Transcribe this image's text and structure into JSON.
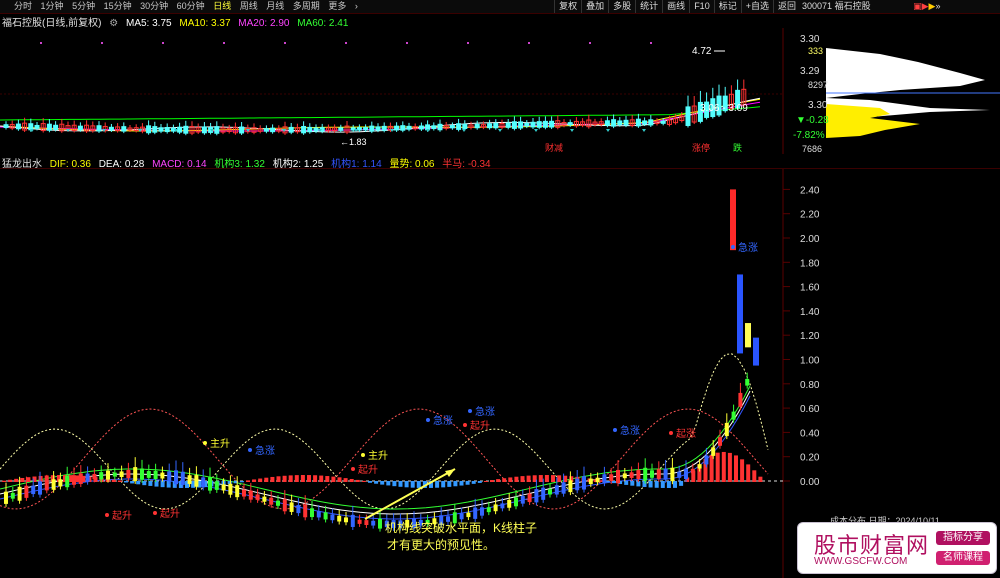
{
  "toolbar": {
    "timeframes": [
      "分时",
      "1分钟",
      "5分钟",
      "15分钟",
      "30分钟",
      "60分钟",
      "日线",
      "周线",
      "月线",
      "多周期",
      "更多"
    ],
    "active": "日线",
    "right_tools": [
      "复权",
      "叠加",
      "多股",
      "统计",
      "画线",
      "F10",
      "标记",
      "+自选",
      "返回"
    ]
  },
  "stock": {
    "code": "300071",
    "name": "福石控股"
  },
  "main_info": {
    "title": "福石控股(日线,前复权)",
    "ma5": "MA5: 3.75",
    "ma10": "MA10: 3.37",
    "ma20": "MA20: 2.90",
    "ma60": "MA60: 2.41"
  },
  "main_annotations": {
    "high": "4.72",
    "low": "1.83",
    "range": "3.06 - 3.09",
    "tags": [
      "财减",
      "涨停",
      "跌"
    ]
  },
  "main_axis": [
    "3.30",
    "3.29"
  ],
  "side_panel": {
    "labels": [
      "333",
      "8297",
      "3.30",
      "-0.28",
      "-7.82%",
      "7686"
    ]
  },
  "indicator_info": {
    "name": "猛龙出水",
    "dif": "DIF: 0.36",
    "dea": "DEA: 0.28",
    "macd": "MACD: 0.14",
    "jg3": "机构3: 1.32",
    "jg2": "机构2: 1.25",
    "jg1": "机构1: 1.14",
    "vol": "量势: 0.06",
    "half": "半马: -0.34"
  },
  "indicator_axis": [
    "2.40",
    "2.20",
    "2.00",
    "1.80",
    "1.60",
    "1.40",
    "1.20",
    "1.00",
    "0.80",
    "0.60",
    "0.40",
    "0.20",
    "0.00"
  ],
  "indicator_labels": {
    "zhu_sheng": "主升",
    "qi_sheng": "起升",
    "ji_zhang": "急涨",
    "qi_zhang": "起涨"
  },
  "note_text": [
    "机构线突破水平面，K线柱子",
    "才有更大的预见性。"
  ],
  "watermark": {
    "title": "股市财富网",
    "url": "WWW.GSCFW.COM",
    "badge1": "指标分享",
    "badge2": "名师课程",
    "peek": "成本分布,日期：2024/10/11"
  },
  "colors": {
    "up": "#ff3232",
    "down": "#54ffff",
    "ma5": "#ffffff",
    "ma10": "#ffff00",
    "ma20": "#ff00ff",
    "ma60": "#00ff00"
  }
}
